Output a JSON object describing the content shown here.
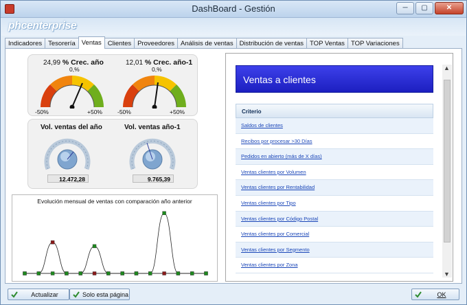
{
  "window": {
    "title": "DashBoard - Gestión",
    "buttons": {
      "min": "─",
      "max": "▢",
      "close": "✕"
    }
  },
  "banner": {
    "logo": "phcenterprise"
  },
  "tabs": [
    {
      "label": "Indicadores"
    },
    {
      "label": "Tesorería"
    },
    {
      "label": "Ventas",
      "active": true
    },
    {
      "label": "Clientes"
    },
    {
      "label": "Proveedores"
    },
    {
      "label": "Análisis de ventas"
    },
    {
      "label": "Distribución de ventas"
    },
    {
      "label": "TOP Ventas"
    },
    {
      "label": "TOP Variaciones"
    }
  ],
  "gauges": {
    "crec_anio": {
      "value": "24,99",
      "title": "% Crec. año",
      "center": "0,%",
      "min": "-50%",
      "max": "+50%"
    },
    "crec_anio1": {
      "value": "12,01",
      "title": "% Crec. año-1",
      "center": "0,%",
      "min": "-50%",
      "max": "+50%"
    },
    "vol_anio": {
      "title": "Vol. ventas del año",
      "value": "12.472,28"
    },
    "vol_anio1": {
      "title": "Vol. ventas año-1",
      "value": "9.765,39"
    }
  },
  "chart_data": {
    "type": "line",
    "title": "Evolución mensual de ventas con comparación año anterior",
    "x": [
      1,
      2,
      3,
      4,
      5,
      6,
      7,
      8,
      9,
      10,
      11,
      12,
      13,
      14
    ],
    "series": [
      {
        "name": "",
        "color": "#8b1a1a",
        "values": [
          0,
          0,
          3.2,
          0,
          0,
          0,
          0,
          0,
          0,
          0,
          0,
          0,
          0,
          0
        ]
      },
      {
        "name": "",
        "color": "#1e8a1e",
        "values": [
          0,
          0,
          0,
          0,
          0,
          2.8,
          0,
          0,
          0,
          0,
          6.2,
          0,
          0,
          0
        ]
      }
    ],
    "ylim": [
      0,
      6.5
    ]
  },
  "right_panel": {
    "header": "Ventas a clientes",
    "column": "Criterio",
    "rows": [
      "Saldos de clientes",
      "Recibos por procesar >30 Días",
      "Pedidos en abierto (más de X días)",
      "Ventas clientes por Volumen",
      "Ventas clientes por Rentabilidad",
      "Ventas clientes por Tipo",
      "Ventas clientes por Código Postal",
      "Ventas clientes por Comercial",
      "Ventas clientes por Segmento",
      "Ventas clientes por Zona"
    ]
  },
  "bottom": {
    "refresh": "Actualizar",
    "this_page": "Solo esta página",
    "ok": "OK"
  }
}
